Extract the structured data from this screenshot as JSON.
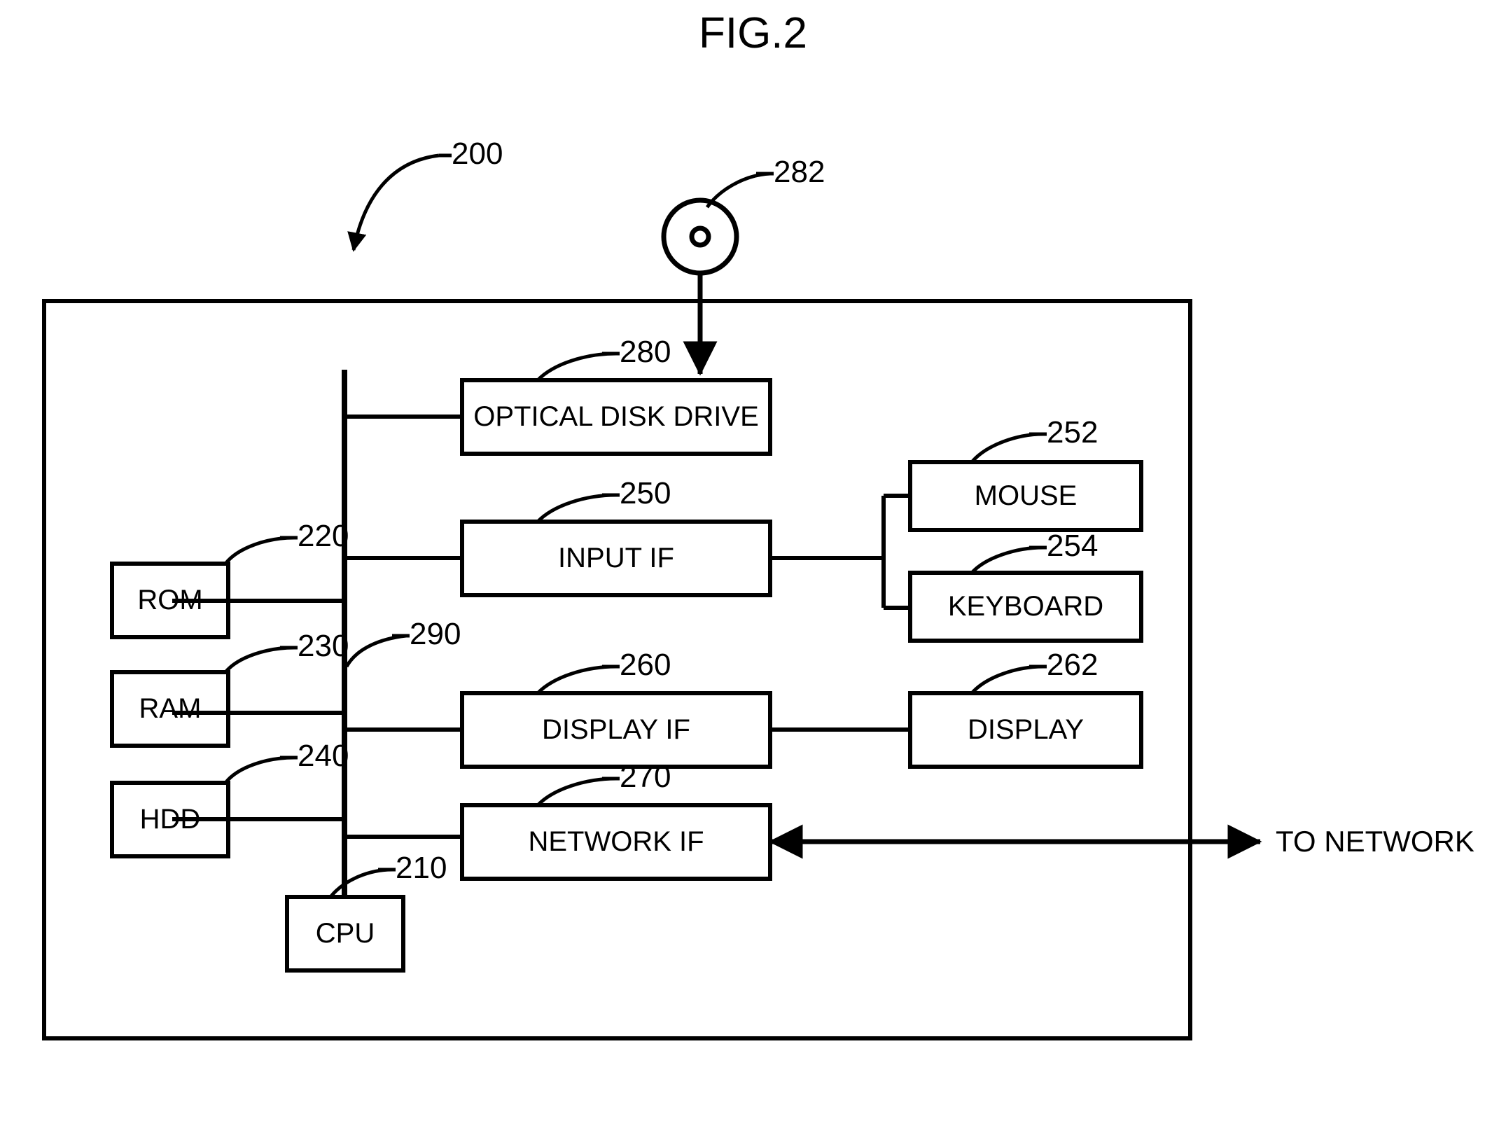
{
  "figure": {
    "title": "FIG.2",
    "system_ref": "200",
    "bus_ref": "290",
    "external_label": "TO NETWORK",
    "media_ref": "282",
    "line_color": "#000000",
    "background_color": "#ffffff"
  },
  "blocks": [
    {
      "id": "cpu",
      "label": "CPU",
      "ref": "210"
    },
    {
      "id": "rom",
      "label": "ROM",
      "ref": "220"
    },
    {
      "id": "ram",
      "label": "RAM",
      "ref": "230"
    },
    {
      "id": "hdd",
      "label": "HDD",
      "ref": "240"
    },
    {
      "id": "input_if",
      "label": "INPUT IF",
      "ref": "250"
    },
    {
      "id": "mouse",
      "label": "MOUSE",
      "ref": "252"
    },
    {
      "id": "keyboard",
      "label": "KEYBOARD",
      "ref": "254"
    },
    {
      "id": "display_if",
      "label": "DISPLAY IF",
      "ref": "260"
    },
    {
      "id": "display",
      "label": "DISPLAY",
      "ref": "262"
    },
    {
      "id": "network_if",
      "label": "NETWORK IF",
      "ref": "270"
    },
    {
      "id": "optical_disk_drive",
      "label": "OPTICAL DISK DRIVE",
      "ref": "280"
    }
  ]
}
